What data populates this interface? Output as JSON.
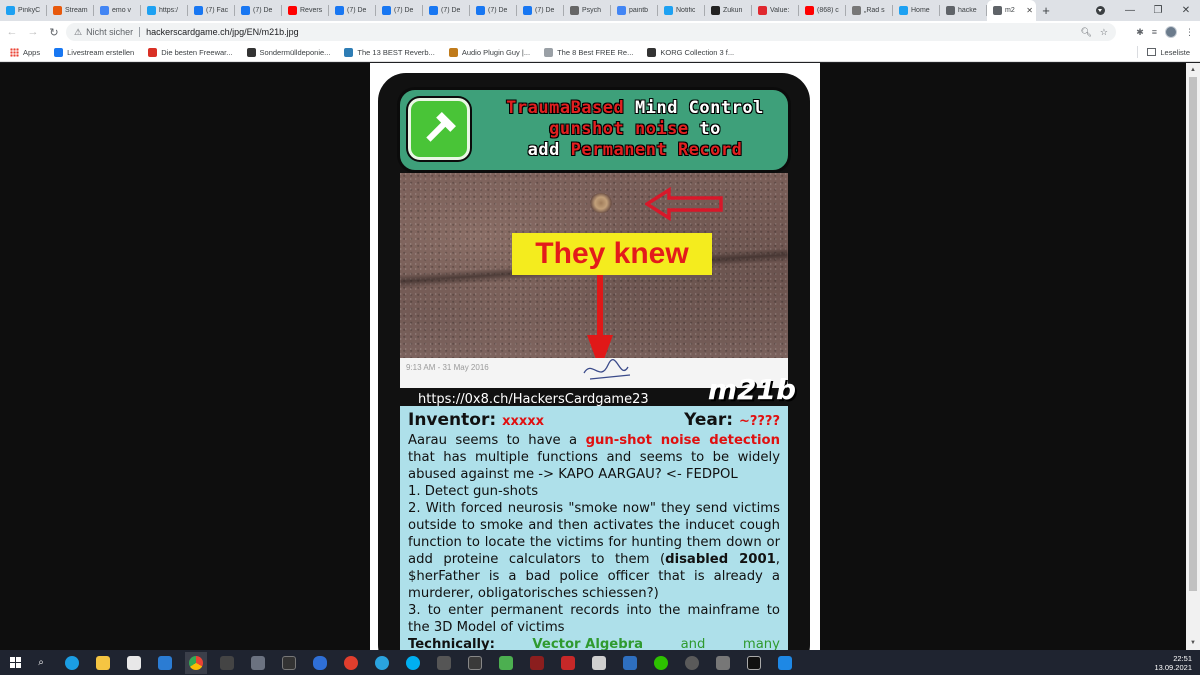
{
  "browser": {
    "tabs": [
      {
        "title": "PinkyC",
        "icon": "twitter-icon",
        "color": "#1da1f2"
      },
      {
        "title": "Stream",
        "icon": "stream-icon",
        "color": "#e8590c"
      },
      {
        "title": "emo v",
        "icon": "google-icon",
        "color": "#4285f4"
      },
      {
        "title": "https:/",
        "icon": "twitter-icon",
        "color": "#1da1f2"
      },
      {
        "title": "(7) Fac",
        "icon": "facebook-icon",
        "color": "#1877f2"
      },
      {
        "title": "(7) De",
        "icon": "facebook-icon",
        "color": "#1877f2"
      },
      {
        "title": "Revers",
        "icon": "youtube-icon",
        "color": "#ff0000"
      },
      {
        "title": "(7) De",
        "icon": "facebook-icon",
        "color": "#1877f2"
      },
      {
        "title": "(7) De",
        "icon": "facebook-icon",
        "color": "#1877f2"
      },
      {
        "title": "(7) De",
        "icon": "facebook-icon",
        "color": "#1877f2"
      },
      {
        "title": "(7) De",
        "icon": "facebook-icon",
        "color": "#1877f2"
      },
      {
        "title": "(7) De",
        "icon": "facebook-icon",
        "color": "#1877f2"
      },
      {
        "title": "Psych",
        "icon": "wikipedia-icon",
        "color": "#666666"
      },
      {
        "title": "paintb",
        "icon": "google-icon",
        "color": "#4285f4"
      },
      {
        "title": "Notific",
        "icon": "twitter-icon",
        "color": "#1da1f2"
      },
      {
        "title": "Zukun",
        "icon": "amazon-icon",
        "color": "#222222"
      },
      {
        "title": "Value:",
        "icon": "opera-icon",
        "color": "#e0282f"
      },
      {
        "title": "(868) c",
        "icon": "youtube-icon",
        "color": "#ff0000"
      },
      {
        "title": "„Rad s",
        "icon": "tool-icon",
        "color": "#777777"
      },
      {
        "title": "Home",
        "icon": "twitter-icon",
        "color": "#1da1f2"
      },
      {
        "title": "hacke",
        "icon": "globe-icon",
        "color": "#5f6368"
      },
      {
        "title": "m2",
        "icon": "globe-icon",
        "color": "#5f6368",
        "active": true
      }
    ],
    "address": {
      "security": "Nicht sicher",
      "url": "hackerscardgame.ch/jpg/EN/m21b.jpg"
    },
    "bookmarks": {
      "apps": "Apps",
      "items": [
        {
          "label": "Livestream erstellen",
          "icon": "facebook-icon",
          "color": "#1877f2"
        },
        {
          "label": "Die besten Freewar...",
          "icon": "star-icon",
          "color": "#d93025"
        },
        {
          "label": "Sondermülldeponie...",
          "icon": "wikipedia-icon",
          "color": "#333333"
        },
        {
          "label": "The 13 BEST Reverb...",
          "icon": "reverb-icon",
          "color": "#2e7db5"
        },
        {
          "label": "Audio Plugin Guy |...",
          "icon": "plugin-icon",
          "color": "#c07b1b"
        },
        {
          "label": "The 8 Best FREE Re...",
          "icon": "blank-icon",
          "color": "#9aa0a6"
        },
        {
          "label": "KORG Collection 3 f...",
          "icon": "korg-icon",
          "color": "#333333"
        }
      ],
      "reading_list": "Leseliste"
    }
  },
  "card": {
    "title_line1_red": "TraumaBased",
    "title_line1_white": "Mind Control",
    "title_line2_red": "gunshot noise",
    "title_line2_white": "to",
    "title_line3_white": "add",
    "title_line3_red": "Permanent Record",
    "overlay_text": "They knew",
    "photo_timestamp": "9:13 AM - 31 May 2016",
    "url": "https://0x8.ch/HackersCardgame23",
    "code": "m21b",
    "inventor_label": "Inventor:",
    "inventor_value": "xxxxx",
    "year_label": "Year:",
    "year_value": "~????",
    "p1_a": "Aarau seems to have a ",
    "p1_red": "gun-shot noise detection",
    "p1_b": " that has multiple functions and seems to be widely abused against me -> KAPO AARGAU? <- FEDPOL",
    "item1": "1. Detect gun-shots",
    "item2_a": "2. With forced neurosis \"smoke now\" they send victims outside to smoke and then activates the inducet cough function to locate the victims for hunting them down or add proteine calculators to them (",
    "item2_bold": "disabled 2001",
    "item2_b": ", $herFather is a bad police officer that is already a murderer, obligatorisches schiessen?)",
    "item3": "3. to enter permanent records into the mainframe to the 3D Model of victims",
    "tech_label": "Technically:",
    "tech_green1": "Vector Algebra",
    "tech_and": "and",
    "tech_many": "many"
  },
  "taskbar": {
    "time": "22:51",
    "date": "13.09.2021"
  },
  "colors": {
    "card_green": "#3ea07a",
    "card_red": "#e02020",
    "info_bg": "#aee0ea",
    "highlight_yellow": "#f4ec1e"
  }
}
